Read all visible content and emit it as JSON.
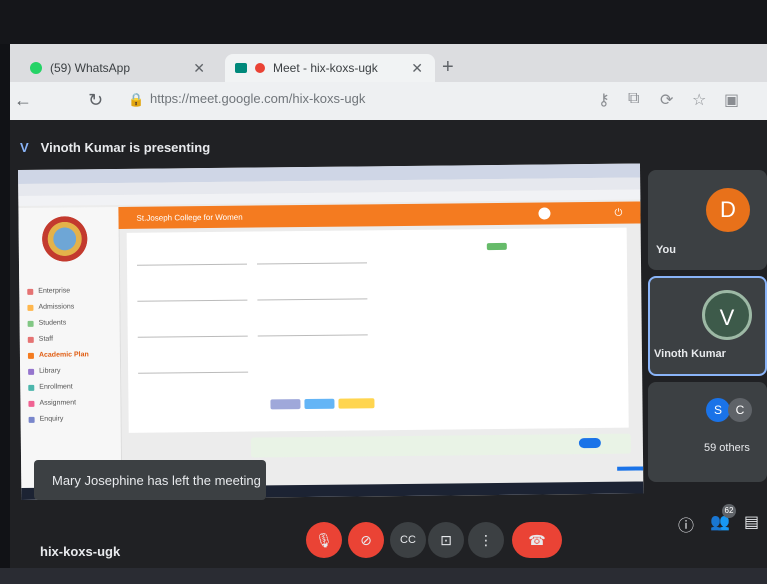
{
  "browser": {
    "tabs": [
      {
        "label": "(59) WhatsApp",
        "active": false
      },
      {
        "label": "Meet - hix-koxs-ugk",
        "active": true
      }
    ],
    "url": "https://meet.google.com/hix-koxs-ugk"
  },
  "meet": {
    "presenter_initial": "V",
    "presenting_banner": "Vinoth Kumar is presenting",
    "toast": "Mary Josephine has left the meeting",
    "meeting_code": "hix-koxs-ugk",
    "participants": {
      "you": {
        "label": "You",
        "initial": "D",
        "color": "#e8711a"
      },
      "presenter": {
        "label": "Vinoth Kumar",
        "initial": "V"
      },
      "others": {
        "label": "59 others",
        "initials": [
          "S",
          "C"
        ]
      }
    },
    "people_count": "62"
  },
  "shared_screen": {
    "college_name": "St.Joseph College for Women",
    "menu": [
      "Enterprise",
      "Admissions",
      "Students",
      "Staff",
      "Academic Plan",
      "Library",
      "Enrollment",
      "Assignment",
      "Enquiry"
    ]
  },
  "colors": {
    "accent": "#f47b20",
    "end_call": "#ea4335",
    "highlight": "#8ab4f8"
  }
}
